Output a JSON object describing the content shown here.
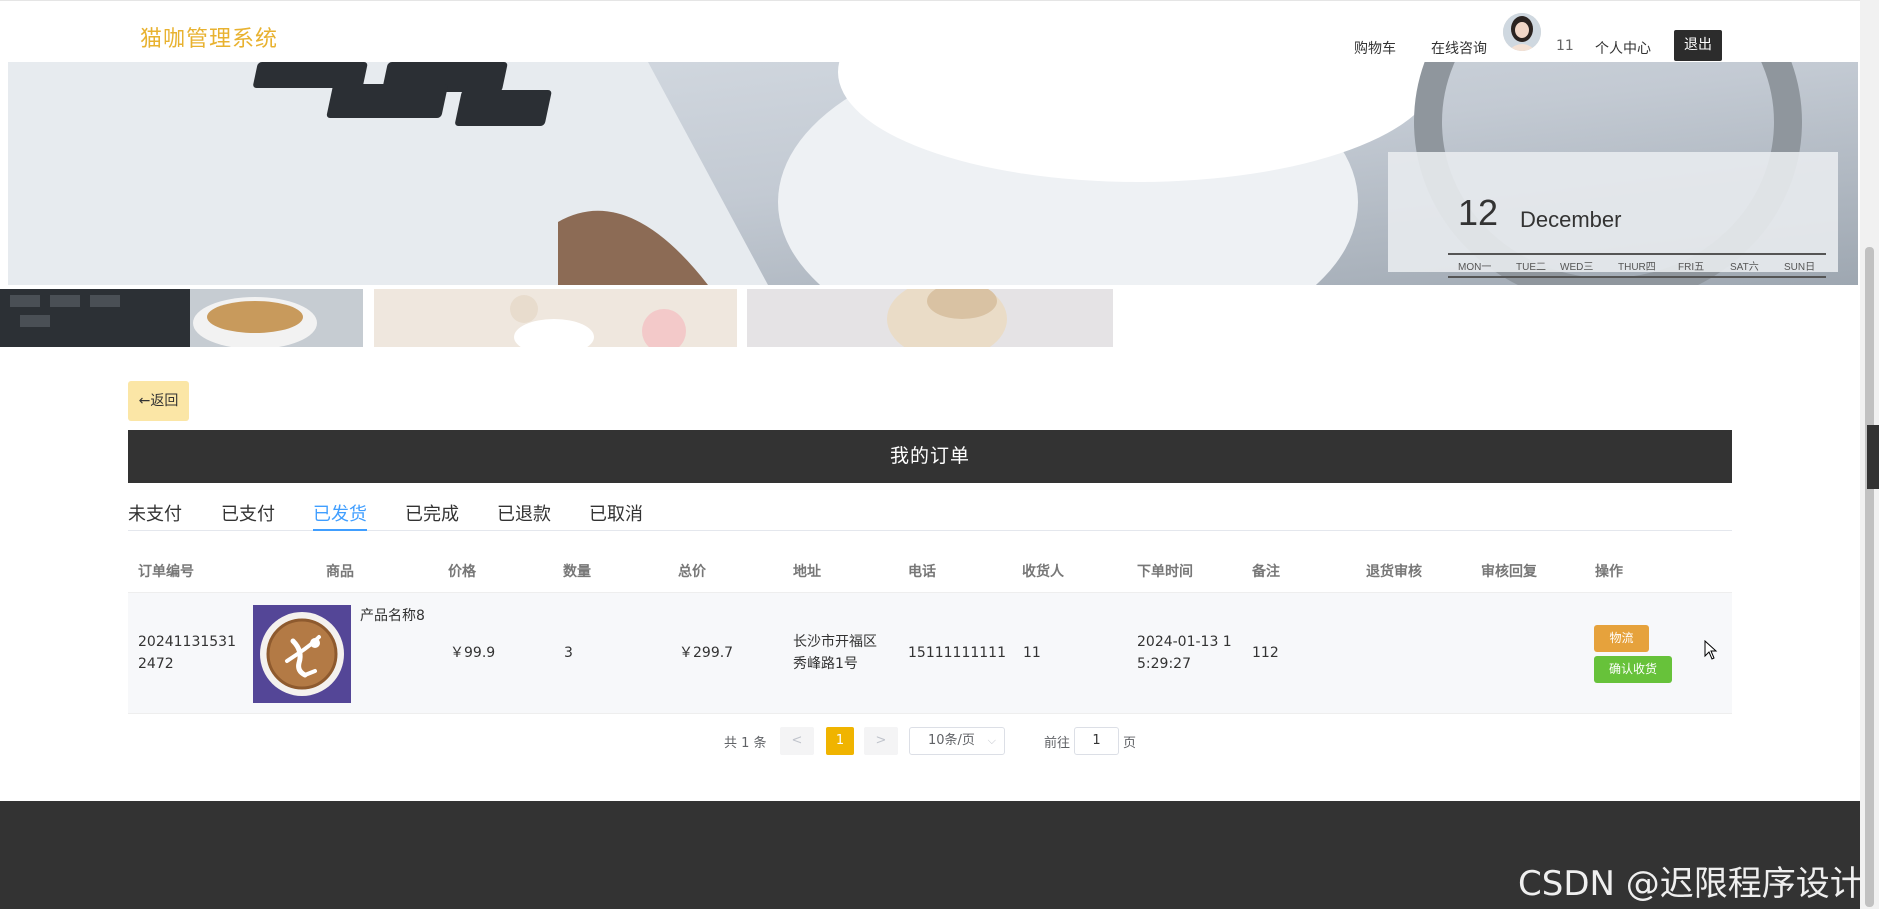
{
  "header": {
    "logo": "猫咖管理系统",
    "nav": {
      "cart": "购物车",
      "consult": "在线咨询",
      "username": "11",
      "personal": "个人中心",
      "logout": "退出"
    }
  },
  "banner": {
    "calendar_day": "12",
    "calendar_month": "December",
    "calendar_weekdays": [
      "MON一",
      "TUE二",
      "WED三",
      "THUR四",
      "FRI五",
      "SAT六",
      "SUN日"
    ]
  },
  "back_label": "←返回",
  "orders_title": "我的订单",
  "tabs": [
    "未支付",
    "已支付",
    "已发货",
    "已完成",
    "已退款",
    "已取消"
  ],
  "active_tab": "已发货",
  "table": {
    "columns": [
      "订单编号",
      "商品",
      "价格",
      "数量",
      "总价",
      "地址",
      "电话",
      "收货人",
      "下单时间",
      "备注",
      "退货审核",
      "审核回复",
      "操作"
    ],
    "rows": [
      {
        "order_no_line1": "20241131531",
        "order_no_line2": "2472",
        "product_name": "产品名称8",
        "price": "￥99.9",
        "qty": "3",
        "total": "￥299.7",
        "address_line1": "长沙市开福区",
        "address_line2": "秀峰路1号",
        "phone": "15111111111",
        "receiver": "11",
        "time_line1": "2024-01-13 1",
        "time_line2": "5:29:27",
        "note": "112",
        "return_review": "",
        "review_reply": "",
        "actions": {
          "logistics": "物流",
          "confirm": "确认收货"
        }
      }
    ]
  },
  "pagination": {
    "total": "共 1 条",
    "prev": "<",
    "current": "1",
    "next": ">",
    "page_size": "10条/页",
    "goto_label": "前往",
    "goto_value": "1",
    "page_label": "页"
  },
  "watermark": "CSDN @迟限程序设计",
  "colors": {
    "brand": "#e8b230",
    "active_tab": "#409eff",
    "logistics": "#e6a23c",
    "confirm": "#67c23a",
    "title_bar": "#333333"
  }
}
